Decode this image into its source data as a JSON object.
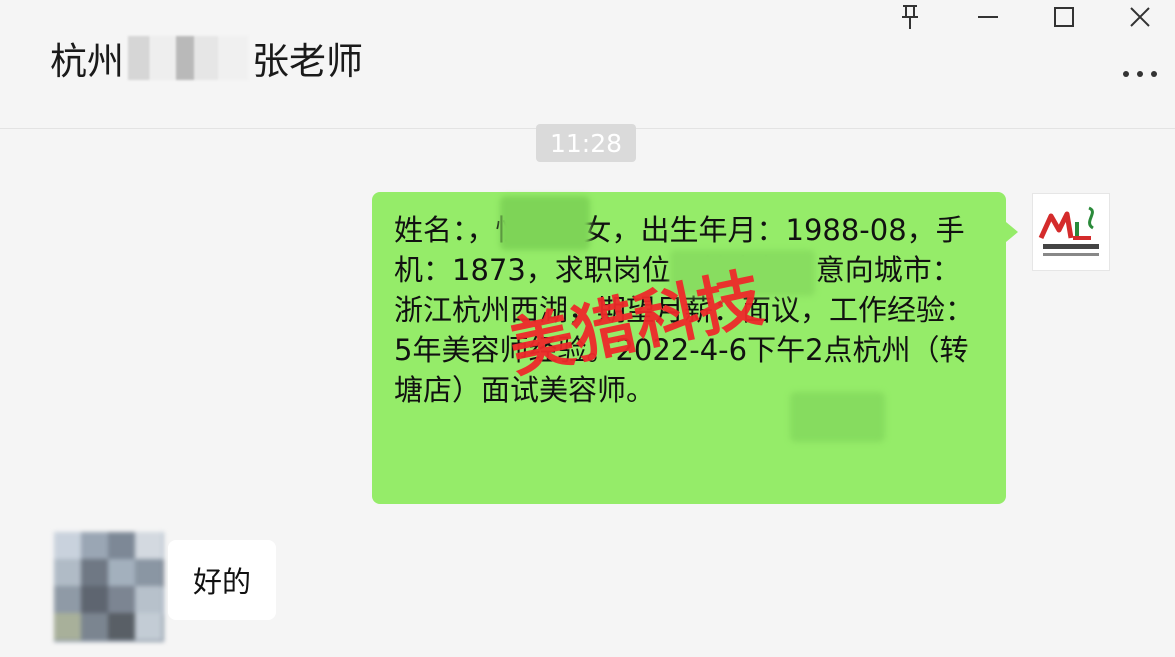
{
  "header": {
    "title_prefix": "杭州",
    "title_suffix": "张老师"
  },
  "window_controls": {
    "pin": "†",
    "minimize": "—",
    "maximize": "□",
    "close": "✕",
    "more": "•••"
  },
  "chat": {
    "time": "11:28",
    "my_message": "姓名：，性别：女，出生年月：1988-08，手机：1873，求职岗位：美容师，意向城市：浙江杭州西湖，期望月薪：面议，工作经验：5年美容师经验。2022-4-6下午2点杭州（转塘店）面试美容师。",
    "other_message": "好的"
  },
  "watermark": {
    "text": "美猎科技",
    "color": "#ee2a2a"
  },
  "colors": {
    "my_bubble": "#95ec69",
    "background": "#f5f5f5"
  },
  "icons": {
    "pin": "pin-icon",
    "minimize": "minimize-icon",
    "maximize": "maximize-icon",
    "close": "close-icon",
    "more": "more-icon"
  }
}
